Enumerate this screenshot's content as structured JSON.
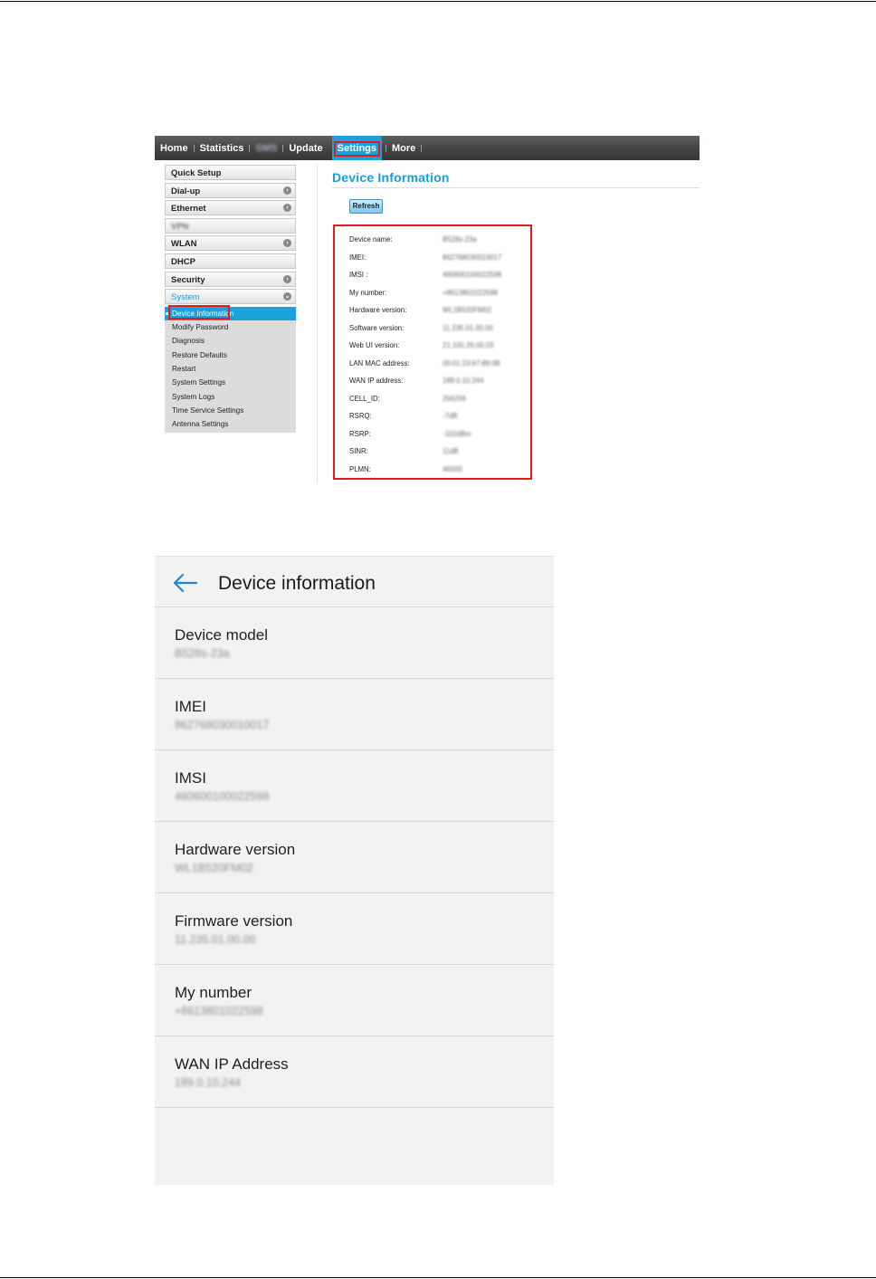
{
  "web": {
    "nav": {
      "home": "Home",
      "statistics": "Statistics",
      "sms": "SMS",
      "update": "Update",
      "settings": "Settings",
      "more": "More"
    },
    "sidebar": {
      "quick_setup": "Quick Setup",
      "dial_up": "Dial-up",
      "ethernet": "Ethernet",
      "vpn": "VPN",
      "wlan": "WLAN",
      "dhcp": "DHCP",
      "security": "Security",
      "system": "System",
      "system_items": [
        "Device Information",
        "Modify Password",
        "Diagnosis",
        "Restore Defaults",
        "Restart",
        "System Settings",
        "System Logs",
        "Time Service Settings",
        "Antenna Settings"
      ]
    },
    "main": {
      "title": "Device Information",
      "refresh_label": "Refresh",
      "rows": [
        {
          "label": "Device name:",
          "value": "B528s-23a"
        },
        {
          "label": "IMEI:",
          "value": "862768030010017"
        },
        {
          "label": "IMSI :",
          "value": "460600100022598"
        },
        {
          "label": "My number:",
          "value": "+8613801022598"
        },
        {
          "label": "Hardware version:",
          "value": "WL1B520FM02"
        },
        {
          "label": "Software version:",
          "value": "11.235.01.00.00"
        },
        {
          "label": "Web UI version:",
          "value": "21.100.26.00.03"
        },
        {
          "label": "LAN MAC address:",
          "value": "00:01:23:67:89:0B"
        },
        {
          "label": "WAN IP address:",
          "value": "189.0.10.244"
        },
        {
          "label": "CELL_ID:",
          "value": "256256"
        },
        {
          "label": "RSRQ:",
          "value": "-7dB"
        },
        {
          "label": "RSRP:",
          "value": "-102dBm"
        },
        {
          "label": "SINR:",
          "value": "11dB"
        },
        {
          "label": "PLMN:",
          "value": "46000"
        }
      ]
    }
  },
  "phone": {
    "title": "Device information",
    "rows": [
      {
        "label": "Device model",
        "value": "B528s-23a"
      },
      {
        "label": "IMEI",
        "value": "862768030010017"
      },
      {
        "label": "IMSI",
        "value": "460600100022598"
      },
      {
        "label": "Hardware version",
        "value": "WL1B520FM02"
      },
      {
        "label": "Firmware version",
        "value": "11.235.01.00.00"
      },
      {
        "label": "My number",
        "value": "+8613801022598"
      },
      {
        "label": "WAN IP Address",
        "value": "189.0.10.244"
      }
    ]
  }
}
